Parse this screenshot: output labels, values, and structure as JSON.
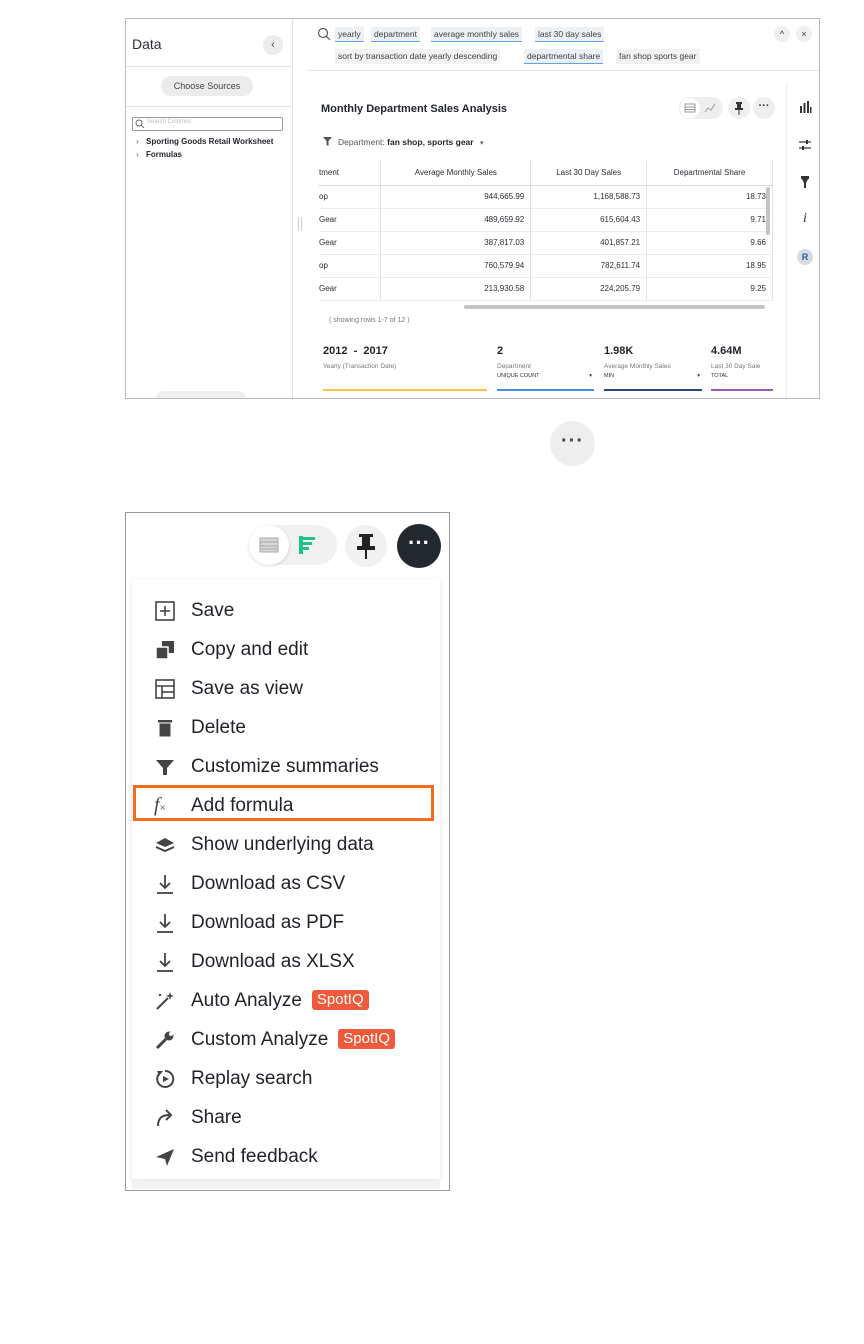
{
  "left_panel": {
    "title": "Data",
    "collapse_glyph": "‹",
    "choose_sources": "Choose Sources",
    "search_placeholder": "Search Columns",
    "tree": [
      "Sporting Goods Retail Worksheet",
      "Formulas"
    ]
  },
  "search": {
    "tokens": [
      "yearly",
      "department",
      "average monthly sales",
      "last 30 day sales",
      "sort by transaction date yearly descending",
      "departmental share",
      "fan shop sports gear"
    ],
    "collapse_glyph": "^",
    "close_glyph": "×"
  },
  "viz": {
    "title": "Monthly Department Sales Analysis",
    "filter_label": "Department:",
    "filter_value": "fan shop, sports gear",
    "more_glyph": "···",
    "columns": [
      "tment",
      "Average Monthly Sales",
      "Last 30 Day Sales",
      "Departmental Share"
    ],
    "rows": [
      [
        "op",
        "944,665.99",
        "1,168,588.73",
        "18.73"
      ],
      [
        "Gear",
        "489,659.92",
        "615,604.43",
        "9.71"
      ],
      [
        "Gear",
        "387,817.03",
        "401,857.21",
        "9.66"
      ],
      [
        "op",
        "760,579.94",
        "782,611.74",
        "18.95"
      ],
      [
        "Gear",
        "213,930.58",
        "224,205.79",
        "9.25"
      ]
    ],
    "rows_note": "( showing rows 1-7 of 12 )",
    "summaries": [
      {
        "value": "2012  -  2017",
        "label": "Yearly (Transaction Date)",
        "sub": "",
        "color": "#f5c643"
      },
      {
        "value": "2",
        "label": "Department",
        "sub": "UNIQUE COUNT",
        "color": "#4a90d9"
      },
      {
        "value": "1.98K",
        "label": "Average Monthly Sales",
        "sub": "MIN",
        "color": "#2e4a7a"
      },
      {
        "value": "4.64M",
        "label": "Last 30 Day Sale",
        "sub": "TOTAL",
        "color": "#9b59b6"
      }
    ]
  },
  "right_rail": [
    "bar-chart-icon",
    "settings-sliders-icon",
    "filter-icon",
    "info-icon",
    "r-icon"
  ],
  "lone_more": "···",
  "zoom": {
    "more_glyph": "···",
    "menu": [
      {
        "label": "Save",
        "icon": "plus-box-icon",
        "badge": ""
      },
      {
        "label": "Copy and edit",
        "icon": "copy-icon",
        "badge": ""
      },
      {
        "label": "Save as view",
        "icon": "table-view-icon",
        "badge": ""
      },
      {
        "label": "Delete",
        "icon": "trash-icon",
        "badge": ""
      },
      {
        "label": "Customize summaries",
        "icon": "filter-icon",
        "badge": ""
      },
      {
        "label": "Add formula",
        "icon": "formula-icon",
        "badge": ""
      },
      {
        "label": "Show underlying data",
        "icon": "layers-icon",
        "badge": ""
      },
      {
        "label": "Download as CSV",
        "icon": "download-icon",
        "badge": ""
      },
      {
        "label": "Download as PDF",
        "icon": "download-icon",
        "badge": ""
      },
      {
        "label": "Download as XLSX",
        "icon": "download-icon",
        "badge": ""
      },
      {
        "label": "Auto Analyze",
        "icon": "magic-wand-icon",
        "badge": "SpotIQ"
      },
      {
        "label": "Custom Analyze",
        "icon": "wrench-icon",
        "badge": "SpotIQ"
      },
      {
        "label": "Replay search",
        "icon": "replay-icon",
        "badge": ""
      },
      {
        "label": "Share",
        "icon": "share-icon",
        "badge": ""
      },
      {
        "label": "Send feedback",
        "icon": "send-icon",
        "badge": ""
      }
    ],
    "highlighted": "Add formula",
    "colors": {
      "highlight": "#f36b1c",
      "spotiq": "#ef5a3c",
      "toggle_green": "#1ec28b"
    }
  }
}
